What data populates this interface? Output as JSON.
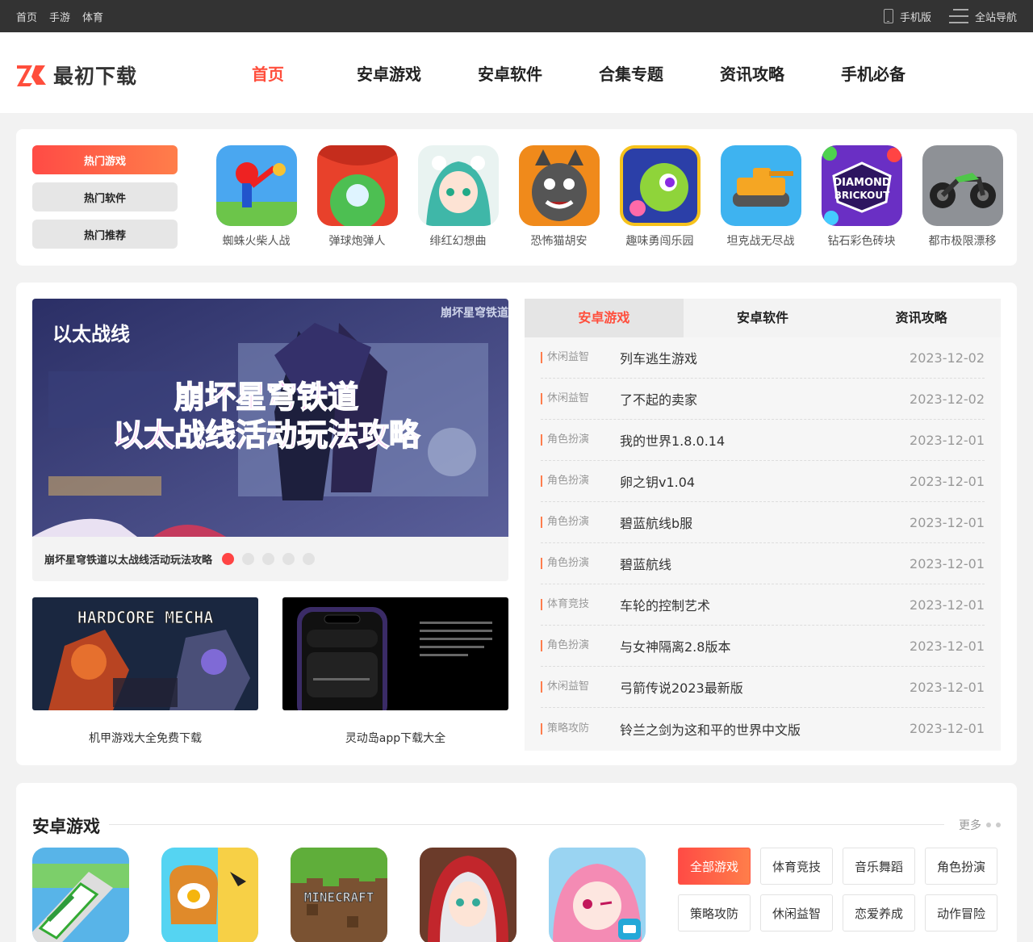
{
  "topbar": {
    "links": [
      "首页",
      "手游",
      "体育"
    ],
    "mobile_label": "手机版",
    "sitenav_label": "全站导航"
  },
  "header": {
    "logo_text": "最初下载",
    "nav": [
      "首页",
      "安卓游戏",
      "安卓软件",
      "合集专题",
      "资讯攻略",
      "手机必备"
    ],
    "active_index": 0
  },
  "hot": {
    "tabs": [
      "热门游戏",
      "热门软件",
      "热门推荐"
    ],
    "games": [
      "蜘蛛火柴人战",
      "弹球炮弹人",
      "绯红幻想曲",
      "恐怖猫胡安",
      "趣味勇闯乐园",
      "坦克战无尽战",
      "钻石彩色砖块",
      "都市极限漂移"
    ]
  },
  "banner": {
    "image_title_1": "以太战线",
    "image_title_2": "崩坏星穹铁道",
    "image_title_3": "以太战线活动玩法攻略",
    "caption": "崩坏星穹铁道以太战线活动玩法攻略",
    "slides": 5,
    "active_slide": 0
  },
  "cards": [
    {
      "title": "机甲游戏大全免费下载",
      "image_text": "HARDCORE MECHA"
    },
    {
      "title": "灵动岛app下载大全"
    }
  ],
  "list": {
    "tabs": [
      "安卓游戏",
      "安卓软件",
      "资讯攻略"
    ],
    "rows": [
      {
        "cat": "休闲益智",
        "title": "列车逃生游戏",
        "date": "2023-12-02"
      },
      {
        "cat": "休闲益智",
        "title": "了不起的卖家",
        "date": "2023-12-02"
      },
      {
        "cat": "角色扮演",
        "title": "我的世界1.8.0.14",
        "date": "2023-12-01"
      },
      {
        "cat": "角色扮演",
        "title": "卵之钥v1.04",
        "date": "2023-12-01"
      },
      {
        "cat": "角色扮演",
        "title": "碧蓝航线b服",
        "date": "2023-12-01"
      },
      {
        "cat": "角色扮演",
        "title": "碧蓝航线",
        "date": "2023-12-01"
      },
      {
        "cat": "体育竞技",
        "title": "车轮的控制艺术",
        "date": "2023-12-01"
      },
      {
        "cat": "角色扮演",
        "title": "与女神隔离2.8版本",
        "date": "2023-12-01"
      },
      {
        "cat": "休闲益智",
        "title": "弓箭传说2023最新版",
        "date": "2023-12-01"
      },
      {
        "cat": "策略攻防",
        "title": "铃兰之剑为这和平的世界中文版",
        "date": "2023-12-01"
      }
    ]
  },
  "android_games": {
    "title": "安卓游戏",
    "more": "更多",
    "minecraft_text": "MINECRAFT",
    "filters": [
      "全部游戏",
      "体育竞技",
      "音乐舞蹈",
      "角色扮演",
      "策略攻防",
      "休闲益智",
      "恋爱养成",
      "动作冒险"
    ]
  },
  "colors": {
    "accent": "#ff4e3c",
    "topbar": "#333333"
  }
}
